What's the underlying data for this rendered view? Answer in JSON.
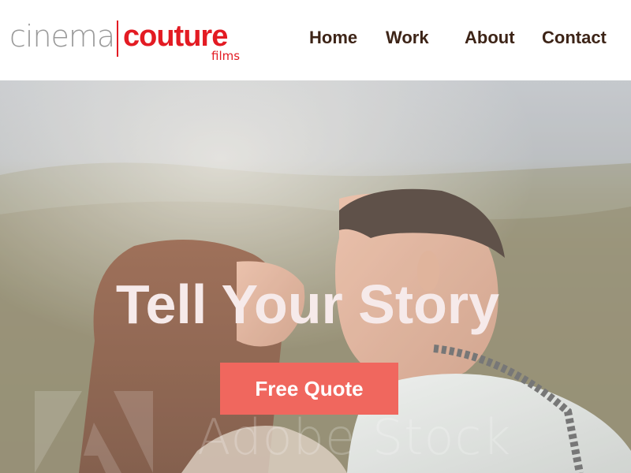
{
  "brand": {
    "word_1": "cinema",
    "word_2": "couture",
    "word_3": "films",
    "colors": {
      "gray": "#9a9a9a",
      "red": "#e31b23"
    }
  },
  "nav": {
    "items": [
      {
        "label": "Home"
      },
      {
        "label": "Work"
      },
      {
        "label": "About"
      },
      {
        "label": "Contact"
      }
    ],
    "color": "#3d2417"
  },
  "hero": {
    "title": "Tell Your Story",
    "cta_label": "Free Quote",
    "cta_color": "#f0675e",
    "watermark": "Adobe Stock",
    "image": "couple-kissing-photo"
  }
}
